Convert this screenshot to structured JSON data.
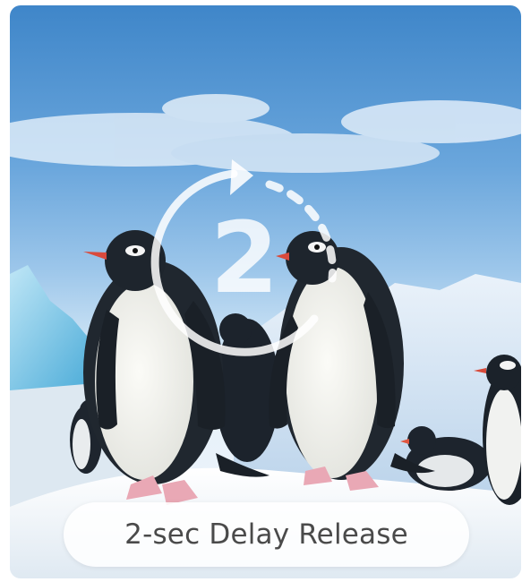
{
  "feature": {
    "countdown_number": "2",
    "label": "2-sec Delay Release",
    "icon": "timer-countdown-icon"
  },
  "colors": {
    "sky_top": "#3f86c9",
    "overlay_white": "#ffffff",
    "pill_text": "#4a4a4a"
  }
}
